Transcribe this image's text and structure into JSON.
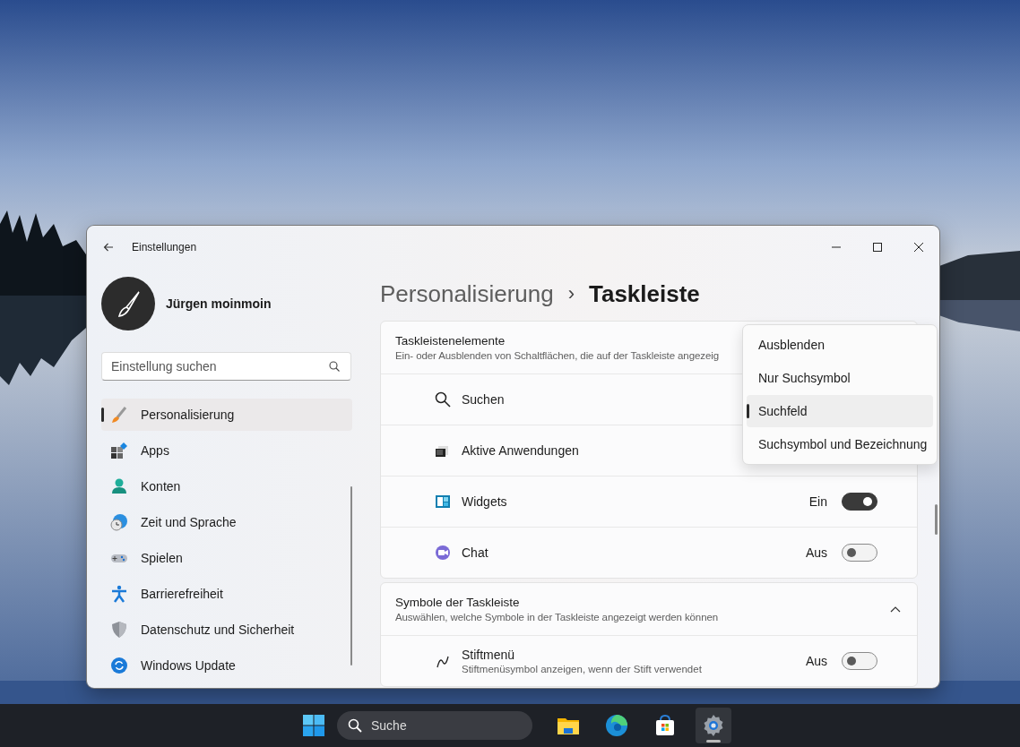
{
  "window": {
    "title": "Einstellungen"
  },
  "profile": {
    "name": "Jürgen moinmoin"
  },
  "sidebar": {
    "search": {
      "placeholder": "Einstellung suchen"
    },
    "items": [
      {
        "label": "Personalisierung",
        "selected": true
      },
      {
        "label": "Apps",
        "selected": false
      },
      {
        "label": "Konten",
        "selected": false
      },
      {
        "label": "Zeit und Sprache",
        "selected": false
      },
      {
        "label": "Spielen",
        "selected": false
      },
      {
        "label": "Barrierefreiheit",
        "selected": false
      },
      {
        "label": "Datenschutz und Sicherheit",
        "selected": false
      },
      {
        "label": "Windows Update",
        "selected": false
      }
    ]
  },
  "breadcrumb": {
    "parent": "Personalisierung",
    "separator": "›",
    "current": "Taskleiste"
  },
  "sections": [
    {
      "title": "Taskleistenelemente",
      "subtitle": "Ein- oder Ausblenden von Schaltflächen, die auf der Taskleiste angezeig",
      "rows": [
        {
          "kind": "plain",
          "label": "Suchen"
        },
        {
          "kind": "plain",
          "label": "Aktive Anwendungen"
        },
        {
          "kind": "toggle",
          "label": "Widgets",
          "state_label": "Ein",
          "on": true
        },
        {
          "kind": "toggle",
          "label": "Chat",
          "state_label": "Aus",
          "on": false
        }
      ]
    },
    {
      "title": "Symbole der Taskleiste",
      "subtitle": "Auswählen, welche Symbole in der Taskleiste angezeigt werden können",
      "expanded": true,
      "rows": [
        {
          "kind": "toggle",
          "label": "Stiftmenü",
          "subtitle": "Stiftmenüsymbol anzeigen, wenn der Stift verwendet",
          "state_label": "Aus",
          "on": false
        }
      ]
    }
  ],
  "dropdown": {
    "options": [
      {
        "label": "Ausblenden",
        "selected": false
      },
      {
        "label": "Nur Suchsymbol",
        "selected": false
      },
      {
        "label": "Suchfeld",
        "selected": true
      },
      {
        "label": "Suchsymbol und Bezeichnung",
        "selected": false
      }
    ]
  },
  "taskbar": {
    "search": {
      "placeholder": "Suche"
    },
    "apps": [
      {
        "selected": false
      },
      {
        "selected": false
      },
      {
        "selected": false
      },
      {
        "selected": true
      }
    ]
  }
}
